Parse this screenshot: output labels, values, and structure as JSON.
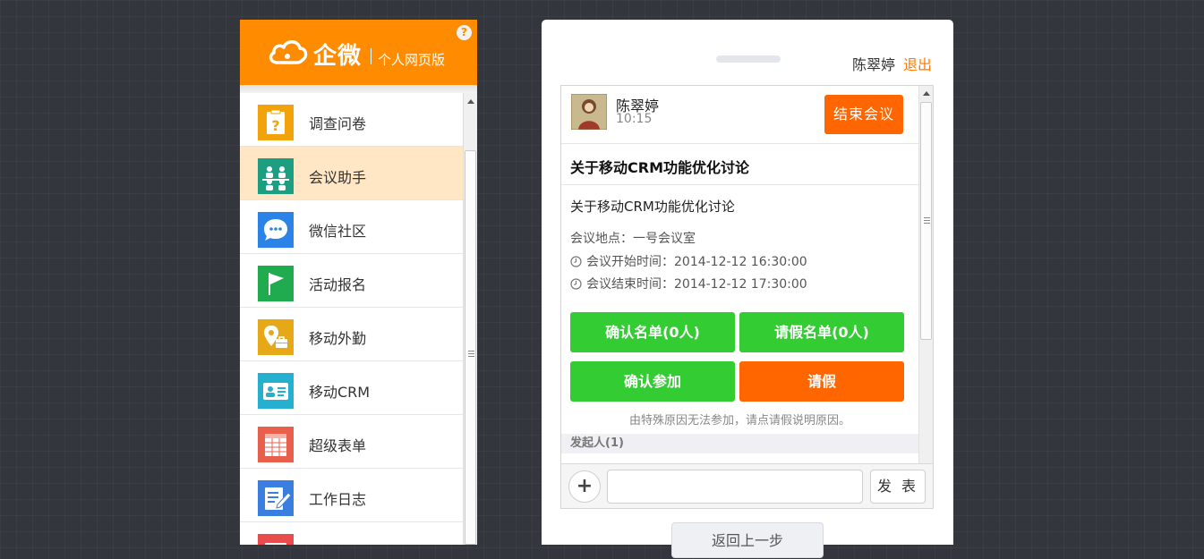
{
  "brand": {
    "name": "企微",
    "subtitle": "个人网页版",
    "help": "?"
  },
  "colors": {
    "brand_orange": "#ff8c00",
    "action_green": "#33cc33",
    "action_orange": "#ff6600",
    "active_item_bg": "#ffe6c4",
    "logout_orange": "#ff7a00"
  },
  "menu": {
    "items": [
      {
        "label": "调查问卷",
        "icon": "survey-icon",
        "color": "#f2a20a"
      },
      {
        "label": "会议助手",
        "icon": "meeting-icon",
        "color": "#1e9e80",
        "active": true
      },
      {
        "label": "微信社区",
        "icon": "chat-bubble-icon",
        "color": "#2b83e8"
      },
      {
        "label": "活动报名",
        "icon": "flag-icon",
        "color": "#1fab4e"
      },
      {
        "label": "移动外勤",
        "icon": "location-pin-icon",
        "color": "#e6a817"
      },
      {
        "label": "移动CRM",
        "icon": "contact-card-icon",
        "color": "#26b0cf"
      },
      {
        "label": "超级表单",
        "icon": "spreadsheet-icon",
        "color": "#e8604c"
      },
      {
        "label": "工作日志",
        "icon": "journal-edit-icon",
        "color": "#3a7fe0"
      }
    ]
  },
  "topbar": {
    "user_name": "陈翠婷",
    "logout_label": "退出"
  },
  "post": {
    "author": "陈翠婷",
    "time": "10:15",
    "end_meeting_label": "结束会议",
    "title": "关于移动CRM功能优化讨论",
    "description": "关于移动CRM功能优化讨论",
    "location": "会议地点：一号会议室",
    "start_time": "会议开始时间：2014-12-12 16:30:00",
    "end_time": "会议结束时间：2014-12-12 17:30:00",
    "confirm_list_label": "确认名单(0人)",
    "leave_list_label": "请假名单(0人)",
    "confirm_join_label": "确认参加",
    "request_leave_label": "请假",
    "leave_hint": "由特殊原因无法参加，请点请假说明原因。",
    "initiator_label": "发起人(1)"
  },
  "composer": {
    "add_symbol": "+",
    "input_value": "",
    "send_label": "发 表"
  },
  "back_label": "返回上一步"
}
